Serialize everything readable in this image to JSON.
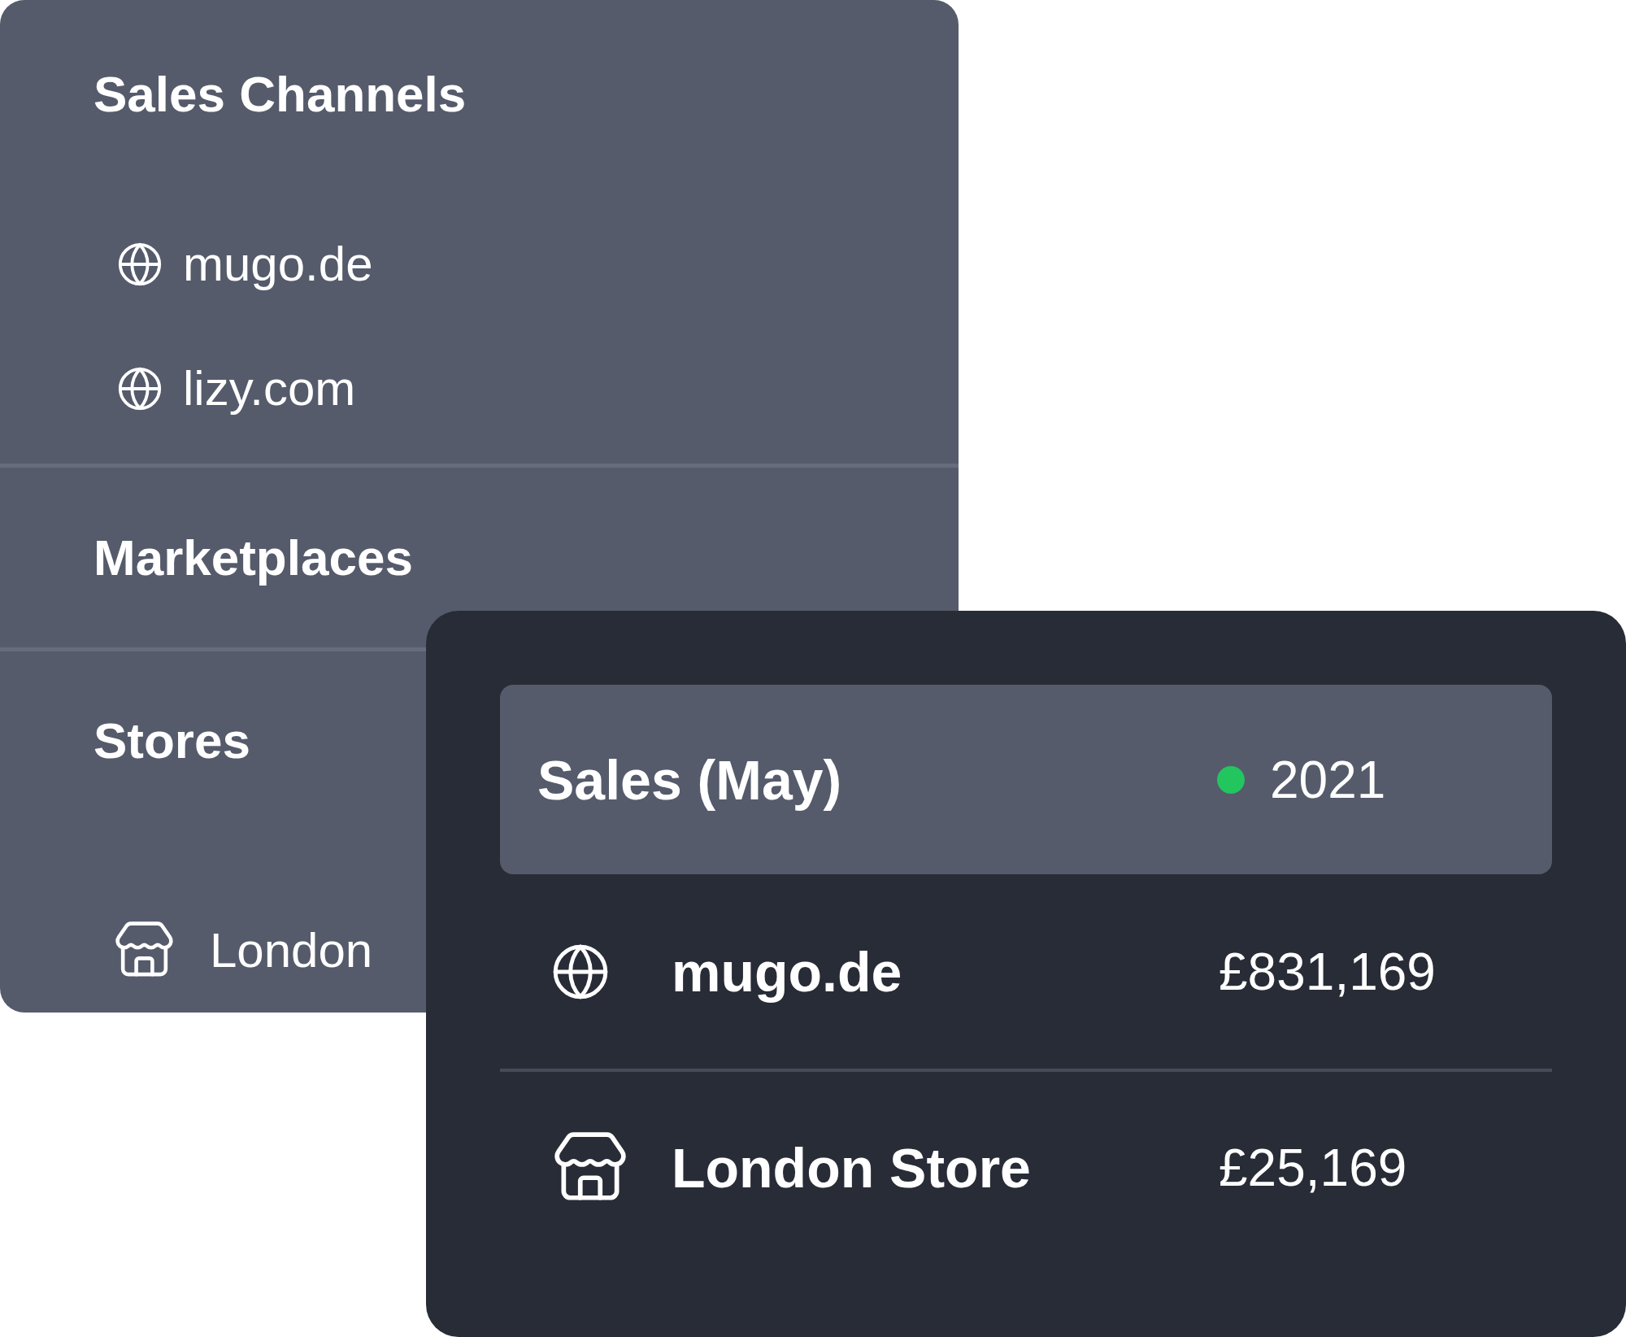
{
  "channels_panel": {
    "sections": [
      {
        "title": "Sales Channels",
        "items": [
          {
            "kind": "website",
            "label": "mugo.de"
          },
          {
            "kind": "website",
            "label": "lizy.com"
          }
        ]
      },
      {
        "title": "Marketplaces"
      },
      {
        "title": "Stores",
        "items": [
          {
            "kind": "store",
            "label": "London"
          }
        ]
      }
    ]
  },
  "sales_card": {
    "title": "Sales (May)",
    "year": "2021",
    "rows": [
      {
        "kind": "website",
        "name": "mugo.de",
        "amount": "£831,169"
      },
      {
        "kind": "store",
        "name": "London Store",
        "amount": "£25,169"
      }
    ]
  }
}
